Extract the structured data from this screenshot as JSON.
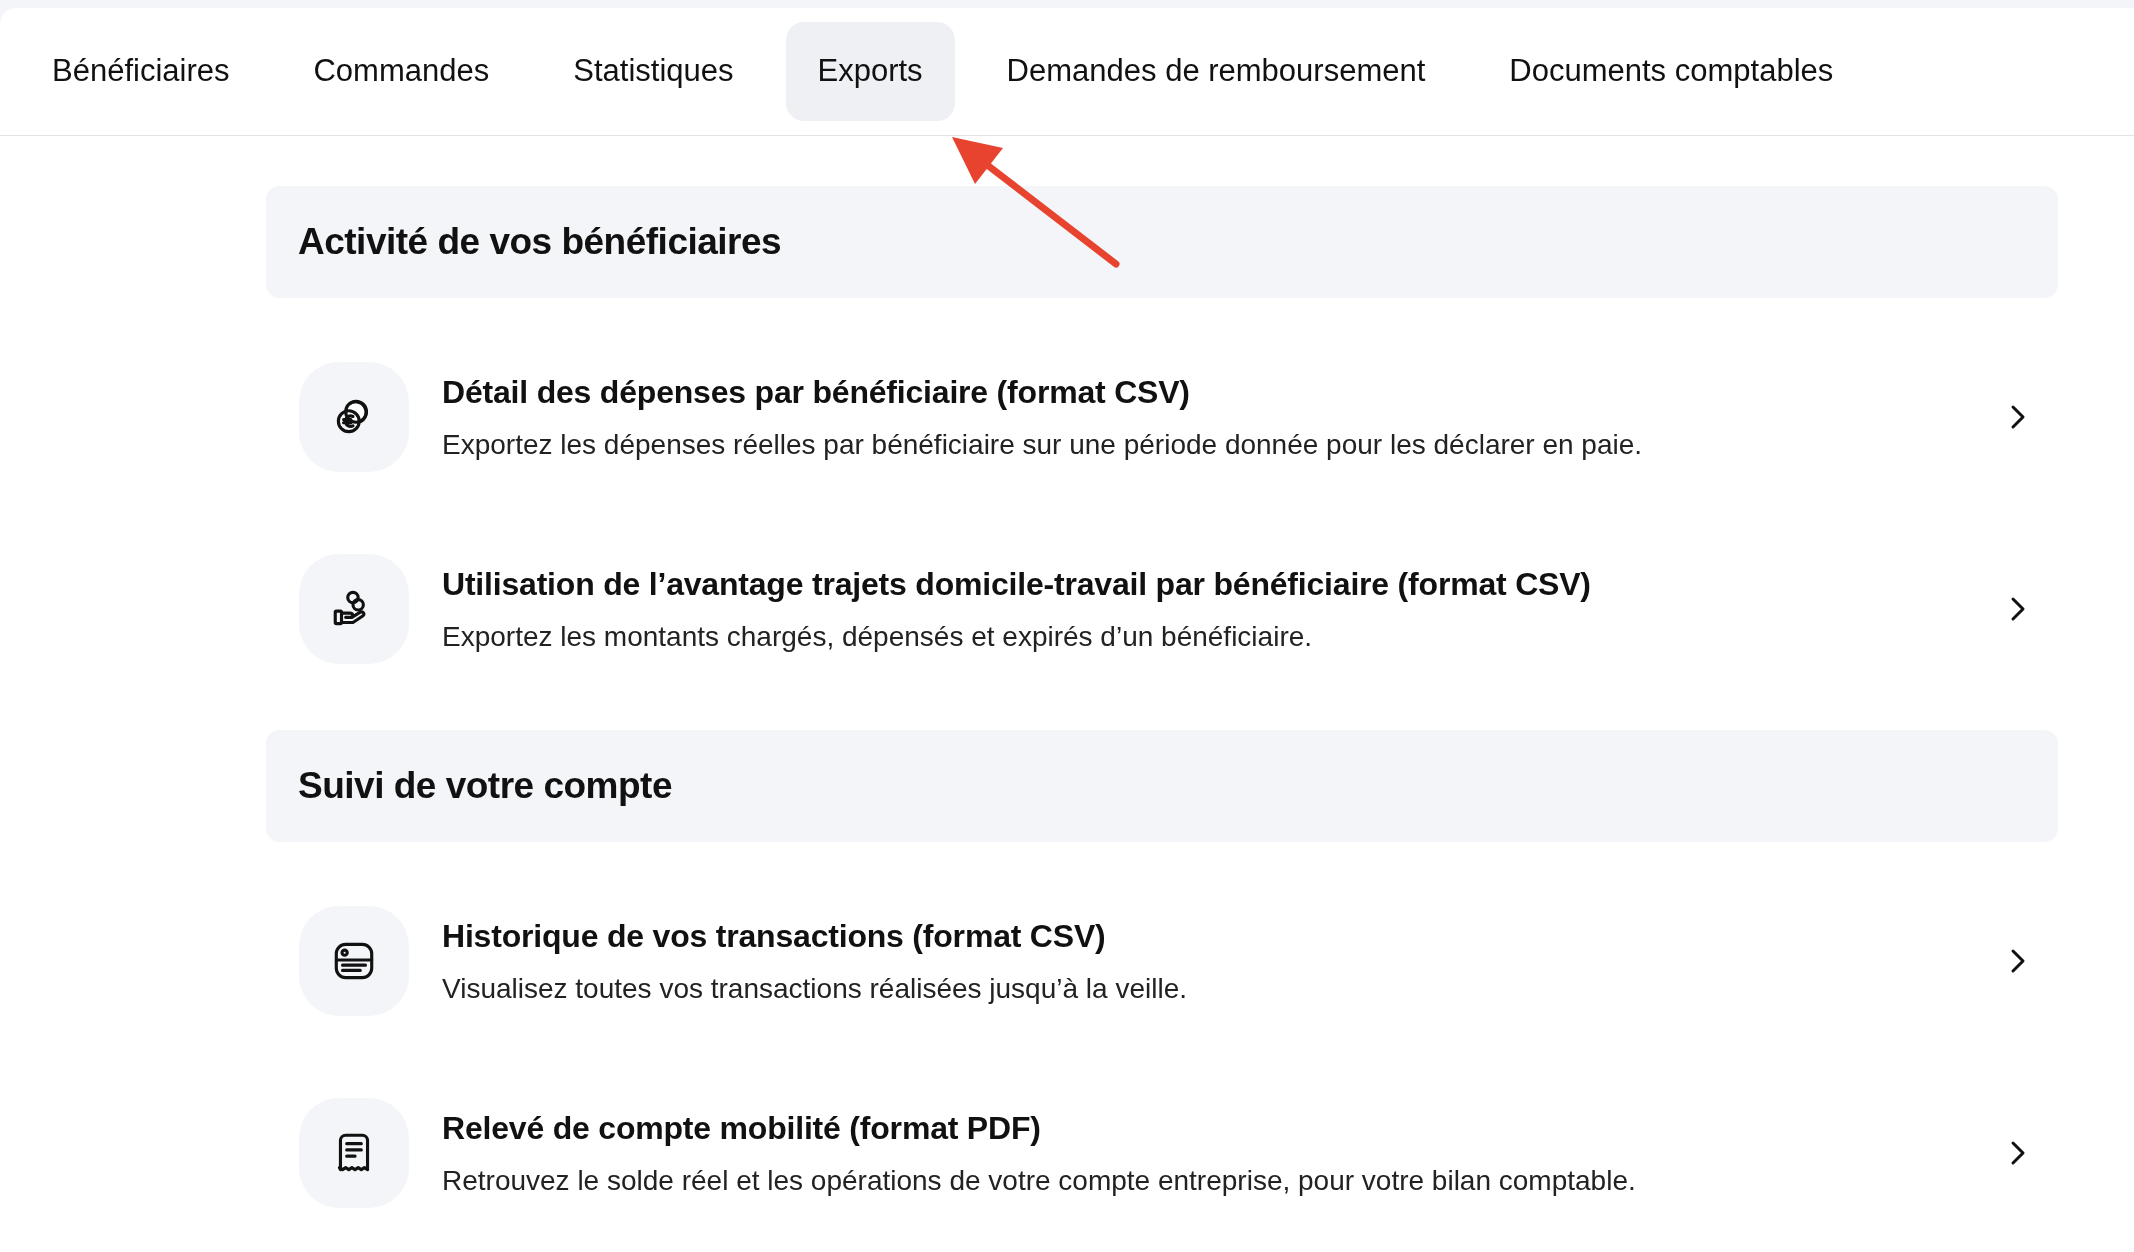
{
  "tabs": [
    {
      "label": "Bénéficiaires",
      "selected": false
    },
    {
      "label": "Commandes",
      "selected": false
    },
    {
      "label": "Statistiques",
      "selected": false
    },
    {
      "label": "Exports",
      "selected": true
    },
    {
      "label": "Demandes de remboursement",
      "selected": false
    },
    {
      "label": "Documents comptables",
      "selected": false
    }
  ],
  "sections": [
    {
      "title": "Activité de vos bénéficiaires",
      "items": [
        {
          "title": "Détail des dépenses par bénéficiaire (format CSV)",
          "description": "Exportez les dépenses réelles par bénéficiaire sur une période donnée pour les déclarer en paie."
        },
        {
          "title": "Utilisation de l’avantage trajets domicile-travail par bénéficiaire (format CSV)",
          "description": "Exportez les montants chargés, dépensés et expirés d’un bénéficiaire."
        }
      ]
    },
    {
      "title": "Suivi de votre compte",
      "items": [
        {
          "title": "Historique de vos transactions (format CSV)",
          "description": "Visualisez toutes vos transactions réalisées jusqu’à la veille."
        },
        {
          "title": "Relevé de compte mobilité (format PDF)",
          "description": "Retrouvez le solde réel et les opérations de votre compte entreprise, pour votre bilan comptable."
        }
      ]
    }
  ]
}
